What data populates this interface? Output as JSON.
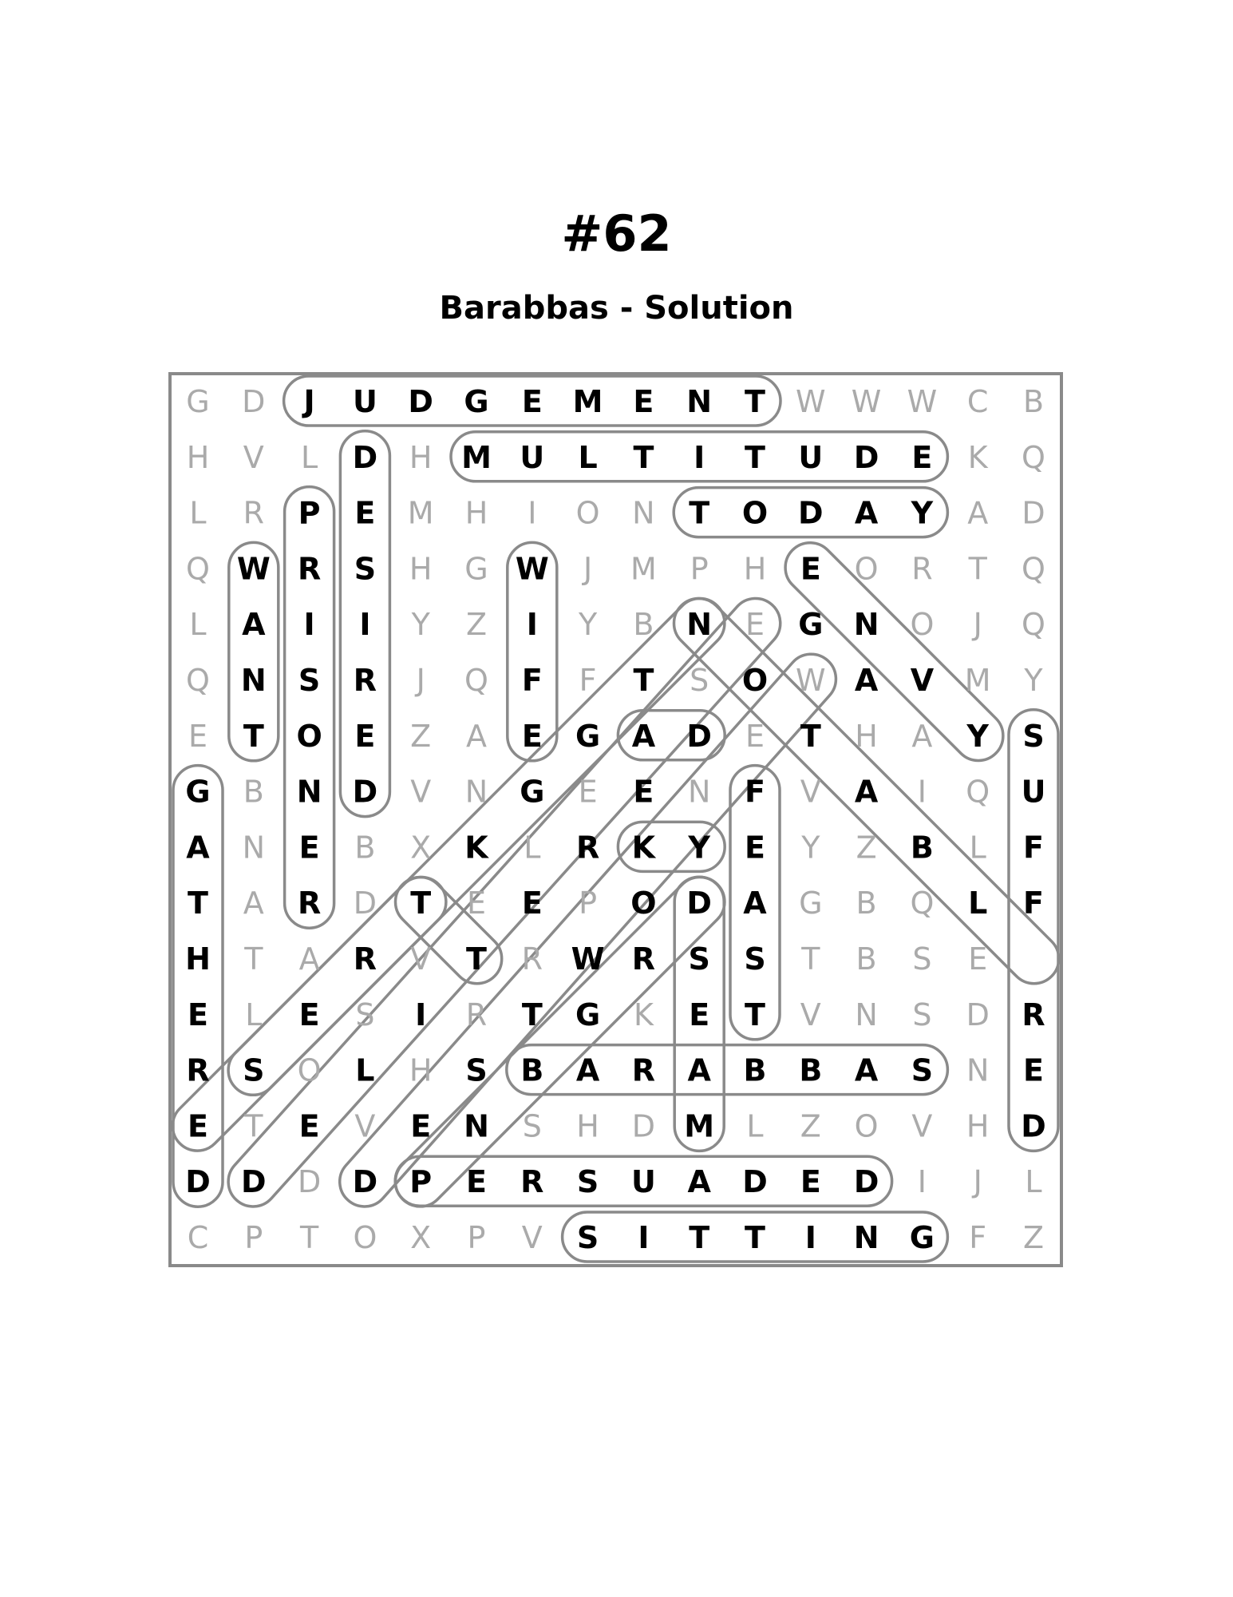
{
  "puzzle": {
    "number": "#62",
    "title": "Barabbas - Solution"
  },
  "grid": [
    "GDJUDGEMENTWWWCB",
    "HVLDHMULTITUDEKQ",
    "LRPEMHIONTODAYAD",
    "QWRSHGWJMPHEORTQ",
    "LAIIYZIYBNEGNOJQ",
    "QNSRJQFFTSOWAVMY",
    "ETOEZAEGADETHAYS",
    "GBNDVNGEENFVAIQU",
    "ANEBXKLRKYEYZBLF",
    "TARDTEEPODAGBQLF",
    "HTARVTRWRSSTBSE",
    "ELESIRTGKETVNSDR",
    "RSOLHSBARABBASNE",
    "ETEVENSHDMLZOVHD",
    "DDDDPERSUADEDIJL",
    "CPTOXPVSITTINGFZ"
  ],
  "words": [
    {
      "word": "JUDGEMENT",
      "start": [
        0,
        2
      ],
      "end": [
        0,
        10
      ]
    },
    {
      "word": "MULTITUDE",
      "start": [
        1,
        5
      ],
      "end": [
        1,
        13
      ]
    },
    {
      "word": "TODAY",
      "start": [
        2,
        9
      ],
      "end": [
        2,
        13
      ]
    },
    {
      "word": "DESIRED",
      "start": [
        1,
        3
      ],
      "end": [
        7,
        3
      ]
    },
    {
      "word": "PRISONER",
      "start": [
        2,
        2
      ],
      "end": [
        9,
        2
      ]
    },
    {
      "word": "WANT",
      "start": [
        3,
        1
      ],
      "end": [
        6,
        1
      ]
    },
    {
      "word": "WIFE",
      "start": [
        3,
        6
      ],
      "end": [
        6,
        6
      ]
    },
    {
      "word": "GATHERED",
      "start": [
        7,
        0
      ],
      "end": [
        14,
        0
      ]
    },
    {
      "word": "SUFFERED",
      "start": [
        6,
        15
      ],
      "end": [
        13,
        15
      ]
    },
    {
      "word": "FEAST",
      "start": [
        7,
        10
      ],
      "end": [
        11,
        10
      ]
    },
    {
      "word": "DREAM",
      "start": [
        9,
        9
      ],
      "end": [
        13,
        9
      ]
    },
    {
      "word": "BARABBAS",
      "start": [
        12,
        6
      ],
      "end": [
        12,
        13
      ]
    },
    {
      "word": "PERSUADED",
      "start": [
        14,
        4
      ],
      "end": [
        14,
        12
      ]
    },
    {
      "word": "SITTING",
      "start": [
        15,
        7
      ],
      "end": [
        15,
        13
      ]
    },
    {
      "word": "EONS",
      "start": [
        3,
        11
      ],
      "end": [
        6,
        14
      ]
    },
    {
      "word": "NOTABLE",
      "start": [
        4,
        9
      ],
      "end": [
        10,
        15
      ]
    },
    {
      "word": "TREES",
      "start": [
        9,
        4
      ],
      "end": [
        10,
        5
      ]
    },
    {
      "word": "KY",
      "start": [
        8,
        8
      ],
      "end": [
        8,
        9
      ]
    },
    {
      "word": "DD",
      "start": [
        13,
        0
      ],
      "end": [
        4,
        9
      ]
    },
    {
      "word": "DELIVERED",
      "start": [
        14,
        1
      ],
      "end": [
        4,
        10
      ]
    },
    {
      "word": "DESTROY",
      "start": [
        14,
        3
      ],
      "end": [
        5,
        11
      ]
    },
    {
      "word": "DIED",
      "start": [
        14,
        4
      ],
      "end": [
        9,
        9
      ]
    },
    {
      "word": "SET",
      "start": [
        12,
        1
      ],
      "end": [
        9,
        4
      ]
    },
    {
      "word": "ADE",
      "start": [
        6,
        8
      ],
      "end": [
        6,
        9
      ]
    }
  ]
}
